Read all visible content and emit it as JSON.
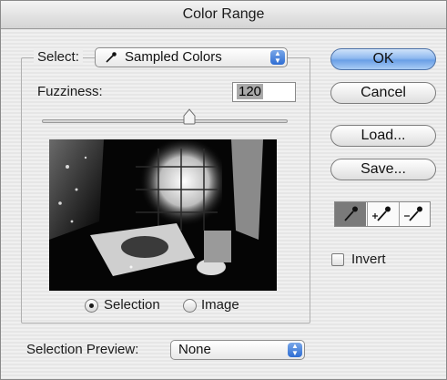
{
  "window": {
    "title": "Color Range"
  },
  "select": {
    "label": "Select:",
    "value": "Sampled Colors",
    "icon": "eyedropper-icon"
  },
  "fuzziness": {
    "label": "Fuzziness:",
    "value": "120",
    "slider_fraction": 0.6
  },
  "preview": {
    "radio_selection": "Selection",
    "radio_image": "Image",
    "selected": "Selection"
  },
  "buttons": {
    "ok": "OK",
    "cancel": "Cancel",
    "load": "Load...",
    "save": "Save..."
  },
  "tools": [
    {
      "name": "eyedropper-icon",
      "active": true
    },
    {
      "name": "eyedropper-plus-icon",
      "active": false
    },
    {
      "name": "eyedropper-minus-icon",
      "active": false
    }
  ],
  "invert": {
    "label": "Invert",
    "checked": false
  },
  "selection_preview": {
    "label": "Selection Preview:",
    "value": "None"
  }
}
